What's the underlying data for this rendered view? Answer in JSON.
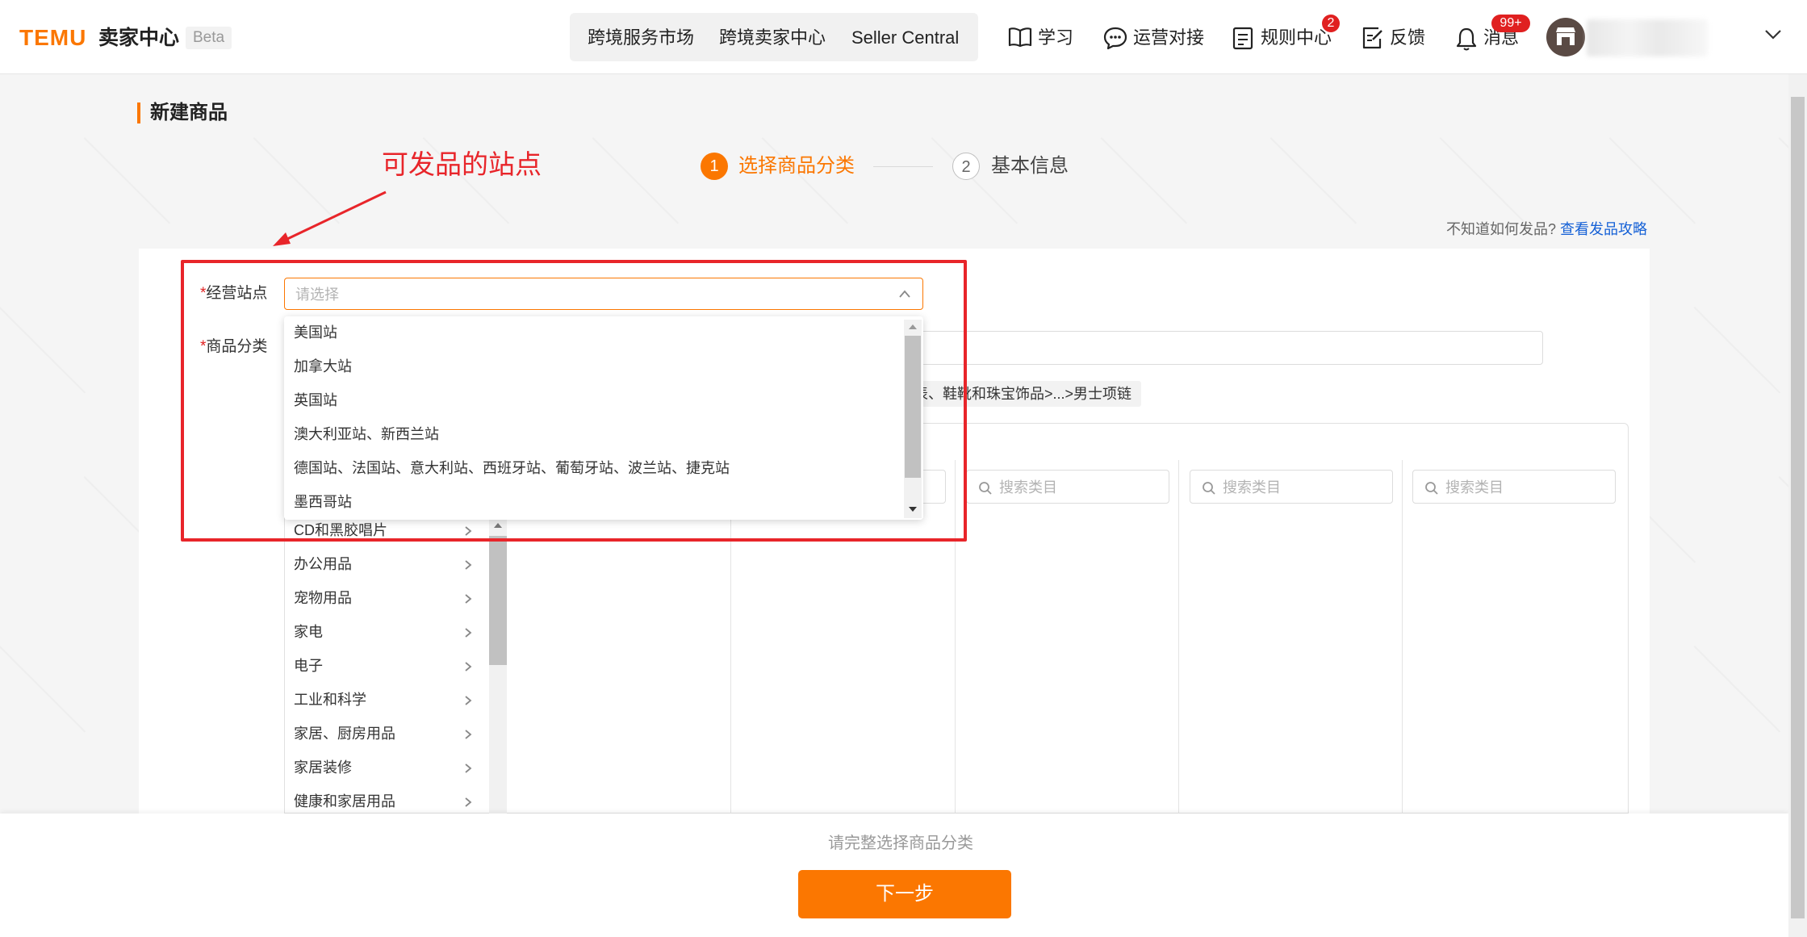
{
  "header": {
    "logo": "TEMU",
    "logo_sub": "卖家中心",
    "beta": "Beta",
    "nav_links": [
      "跨境服务市场",
      "跨境卖家中心",
      "Seller Central"
    ],
    "tools": {
      "learn": "学习",
      "ops": "运营对接",
      "rules": "规则中心",
      "rules_badge": "2",
      "feedback": "反馈",
      "messages": "消息",
      "messages_badge": "99+"
    }
  },
  "page": {
    "title": "新建商品",
    "annotation": "可发品的站点",
    "steps": [
      {
        "num": "1",
        "label": "选择商品分类"
      },
      {
        "num": "2",
        "label": "基本信息"
      }
    ],
    "help_text": "不知道如何发品?",
    "help_link": "查看发品攻略"
  },
  "form": {
    "site_label": "经营站点",
    "site_placeholder": "请选择",
    "category_label": "商品分类",
    "breadcrumb": "表、鞋靴和珠宝饰品>...>男士项链",
    "search_placeholder": "搜索类目"
  },
  "site_options": [
    "美国站",
    "加拿大站",
    "英国站",
    "澳大利亚站、新西兰站",
    "德国站、法国站、意大利站、西班牙站、葡萄牙站、波兰站、捷克站",
    "墨西哥站"
  ],
  "categories": [
    "CD和黑胶唱片",
    "办公用品",
    "宠物用品",
    "家电",
    "电子",
    "工业和科学",
    "家居、厨房用品",
    "家居装修",
    "健康和家居用品"
  ],
  "footer": {
    "hint": "请完整选择商品分类",
    "next_label": "下一步"
  },
  "colors": {
    "accent": "#fb7701",
    "annotation": "#e8252a",
    "link": "#1460d6"
  }
}
